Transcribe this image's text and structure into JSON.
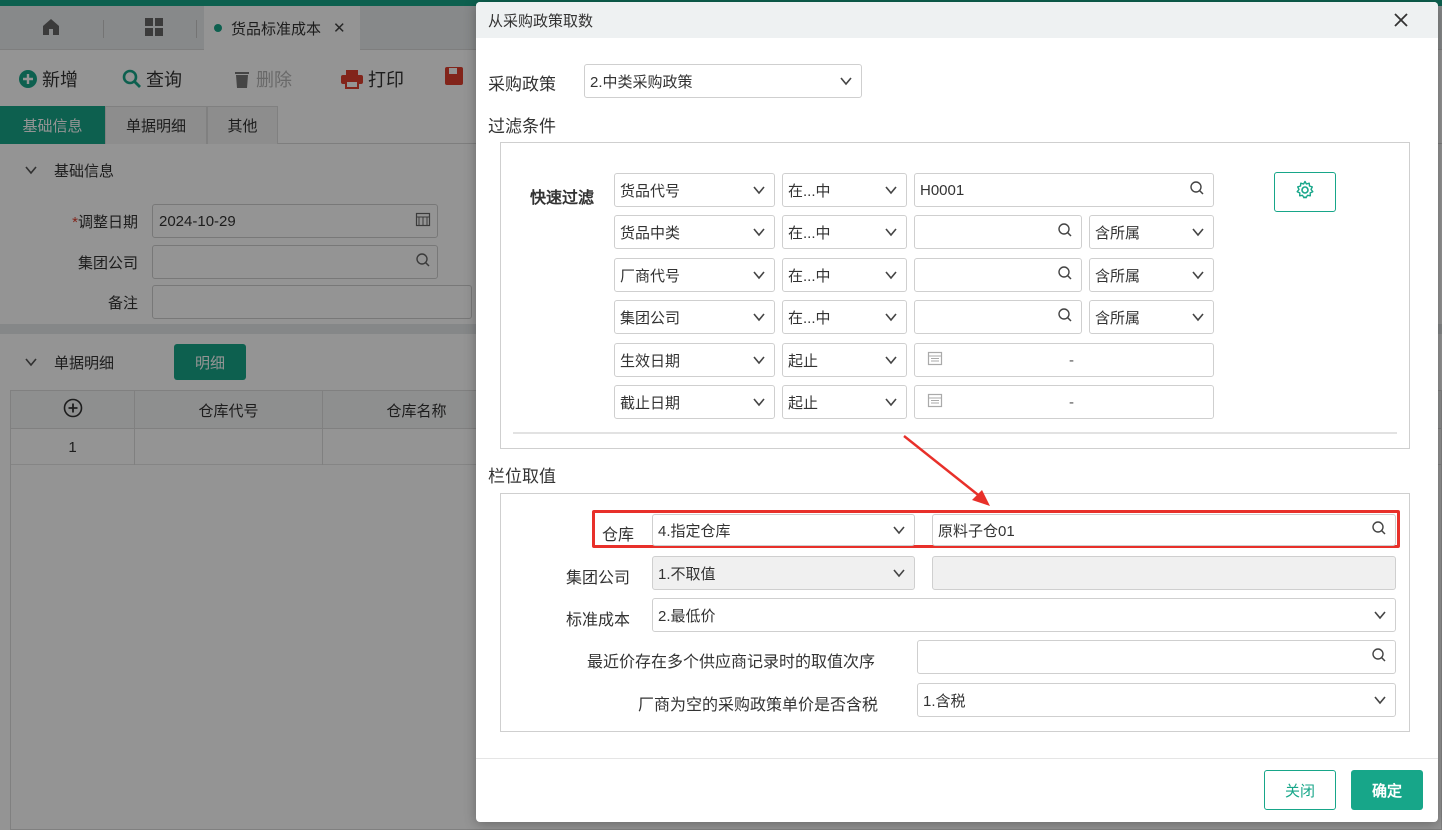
{
  "tabs": {
    "doc_tab_label": "货品标准成本"
  },
  "toolbar": {
    "add": "新增",
    "query": "查询",
    "delete": "删除",
    "print": "打印"
  },
  "subtabs": [
    "基础信息",
    "单据明细",
    "其他"
  ],
  "basic_section": {
    "title": "基础信息",
    "adjust_date_label": "调整日期",
    "required_mark": "*",
    "adjust_date_value": "2024-10-29",
    "group_company_label": "集团公司",
    "remark_label": "备注"
  },
  "detail_section": {
    "title": "单据明细",
    "detail_button": "明细",
    "columns": [
      "仓库代号",
      "仓库名称"
    ],
    "rows": [
      {
        "index": "1"
      }
    ]
  },
  "dialog": {
    "title": "从采购政策取数",
    "policy_label": "采购政策",
    "policy_value": "2.中类采购政策",
    "filter_label": "过滤条件",
    "quick_filter_label": "快速过滤",
    "filters": [
      {
        "field": "货品代号",
        "op": "在...中",
        "value": "H0001",
        "scope": ""
      },
      {
        "field": "货品中类",
        "op": "在...中",
        "value": "",
        "scope": "含所属"
      },
      {
        "field": "厂商代号",
        "op": "在...中",
        "value": "",
        "scope": "含所属"
      },
      {
        "field": "集团公司",
        "op": "在...中",
        "value": "",
        "scope": "含所属"
      },
      {
        "field": "生效日期",
        "op": "起止",
        "range_sep": "-"
      },
      {
        "field": "截止日期",
        "op": "起止",
        "range_sep": "-"
      }
    ],
    "column_values_label": "栏位取值",
    "column_fields": {
      "warehouse_label": "仓库",
      "warehouse_mode": "4.指定仓库",
      "warehouse_value": "原料子仓01",
      "group_label": "集团公司",
      "group_mode": "1.不取值",
      "std_cost_label": "标准成本",
      "std_cost_mode": "2.最低价",
      "recent_price_label": "最近价存在多个供应商记录时的取值次序",
      "recent_price_value": "",
      "tax_label": "厂商为空的采购政策单价是否含税",
      "tax_value": "1.含税"
    },
    "close_button": "关闭",
    "ok_button": "确定"
  },
  "colors": {
    "accent": "#17a689",
    "highlight": "#e8302a"
  }
}
